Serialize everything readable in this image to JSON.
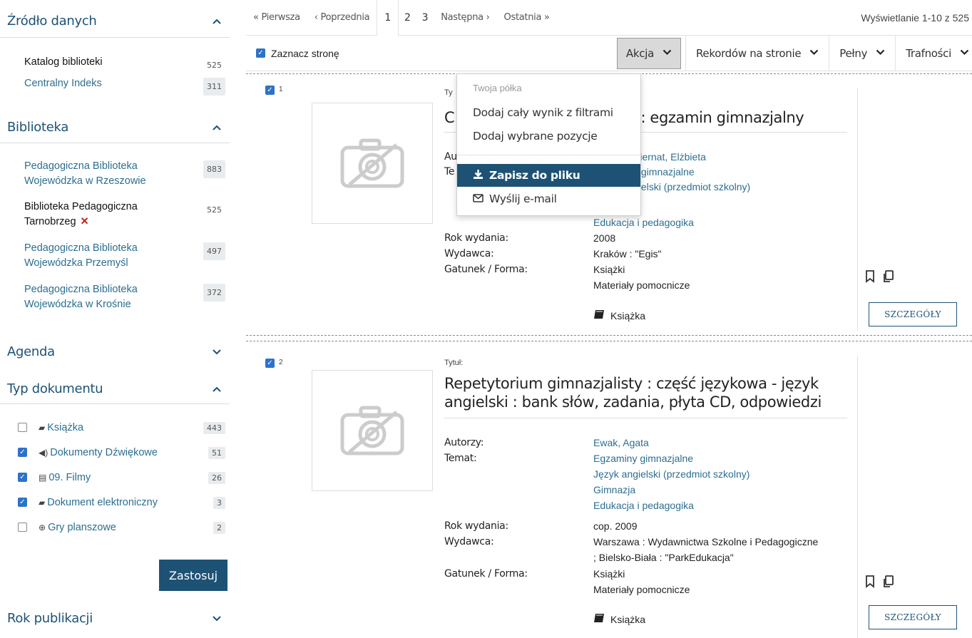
{
  "sidebar": {
    "source": {
      "title": "Źródło danych",
      "items": [
        {
          "label": "Katalog biblioteki",
          "count": "525"
        },
        {
          "label": "Centralny Indeks",
          "count": "311"
        }
      ]
    },
    "library": {
      "title": "Biblioteka",
      "items": [
        {
          "label": "Pedagogiczna Biblioteka Wojewódzka w Rzeszowie",
          "count": "883"
        },
        {
          "label": "Biblioteka Pedagogiczna Tarnobrzeg",
          "count": "525"
        },
        {
          "label": "Pedagogiczna Biblioteka Wojewódzka Przemyśl",
          "count": "497"
        },
        {
          "label": "Pedagogiczna Biblioteka Wojewódzka w Krośnie",
          "count": "372"
        }
      ]
    },
    "agenda": {
      "title": "Agenda"
    },
    "doc_type": {
      "title": "Typ dokumentu",
      "items": [
        {
          "label": "Książka",
          "count": "443",
          "checked": false,
          "icon": "book-icon"
        },
        {
          "label": "Dokumenty Dźwiękowe",
          "count": "51",
          "checked": true,
          "icon": "speaker-icon"
        },
        {
          "label": "09. Filmy",
          "count": "26",
          "checked": true,
          "icon": "film-icon"
        },
        {
          "label": "Dokument elektroniczny",
          "count": "3",
          "checked": true,
          "icon": "electronic-doc-icon"
        },
        {
          "label": "Gry planszowe",
          "count": "2",
          "checked": false,
          "icon": "board-game-icon"
        }
      ],
      "apply_label": "Zastosuj"
    },
    "year": {
      "title": "Rok publikacji"
    }
  },
  "pager": {
    "first": "« Pierwsza",
    "prev": "‹ Poprzednia",
    "pages": [
      "1",
      "2",
      "3"
    ],
    "current": "1",
    "next": "Następna ›",
    "last": "Ostatnia »",
    "info": "Wyświetlanie 1-10 z 525"
  },
  "toolbar": {
    "select_page": "Zaznacz stronę",
    "action": "Akcja",
    "per_page": "Rekordów na stronie",
    "view": "Pełny",
    "sort": "Trafności"
  },
  "dropdown": {
    "header": "Twoja półka",
    "items": [
      {
        "label": "Dodaj cały wynik z filtrami"
      },
      {
        "label": "Dodaj wybrane pozycje"
      },
      {
        "label": "Zapisz do pliku"
      },
      {
        "label": "Wyślij e-mail"
      }
    ]
  },
  "records": [
    {
      "num": "1",
      "label": "Tytuł:",
      "title": "C… ki : egzamin gimnazjalny",
      "title_visible_left": "C",
      "title_visible_right": "ki : egzamin gimnazjalny",
      "fields": {
        "authors_label": "Autorzy:",
        "authors_partial": "Au",
        "authors": "Biernat, Elżbieta",
        "subject_label": "Temat:",
        "subject_partial": "Te",
        "subjects": [
          "y gimnazjalne",
          "gielski (przedmiot szkolny)",
          "Edukacja i pedagogika"
        ],
        "year_label": "Rok wydania:",
        "year": "2008",
        "publisher_label": "Wydawca:",
        "publisher": "Kraków : \"Egis\"",
        "genre_label": "Gatunek / Forma:",
        "genres": [
          "Książki",
          "Materiały pomocnicze"
        ],
        "format": "Książka"
      },
      "details": "SZCZEGÓŁY"
    },
    {
      "num": "2",
      "label": "Tytuł:",
      "title": "Repetytorium gimnazjalisty : część językowa - język angielski : bank słów, zadania, płyta CD, odpowiedzi",
      "fields": {
        "authors_label": "Autorzy:",
        "authors": "Ewak, Agata",
        "subject_label": "Temat:",
        "subjects": [
          "Egzaminy gimnazjalne",
          "Język angielski (przedmiot szkolny)",
          "Gimnazja",
          "Edukacja i pedagogika"
        ],
        "year_label": "Rok wydania:",
        "year": "cop. 2009",
        "publisher_label": "Wydawca:",
        "publisher_lines": [
          "Warszawa : Wydawnictwa Szkolne i Pedagogiczne",
          "; Bielsko-Biała : \"ParkEdukacja\""
        ],
        "genre_label": "Gatunek / Forma:",
        "genres": [
          "Książki",
          "Materiały pomocnicze"
        ],
        "format": "Książka"
      },
      "details": "SZCZEGÓŁY"
    }
  ],
  "colors": {
    "brand": "#1d5275",
    "link": "#2c6e91",
    "checkbox": "#2e72c8",
    "remove": "#c82020"
  }
}
